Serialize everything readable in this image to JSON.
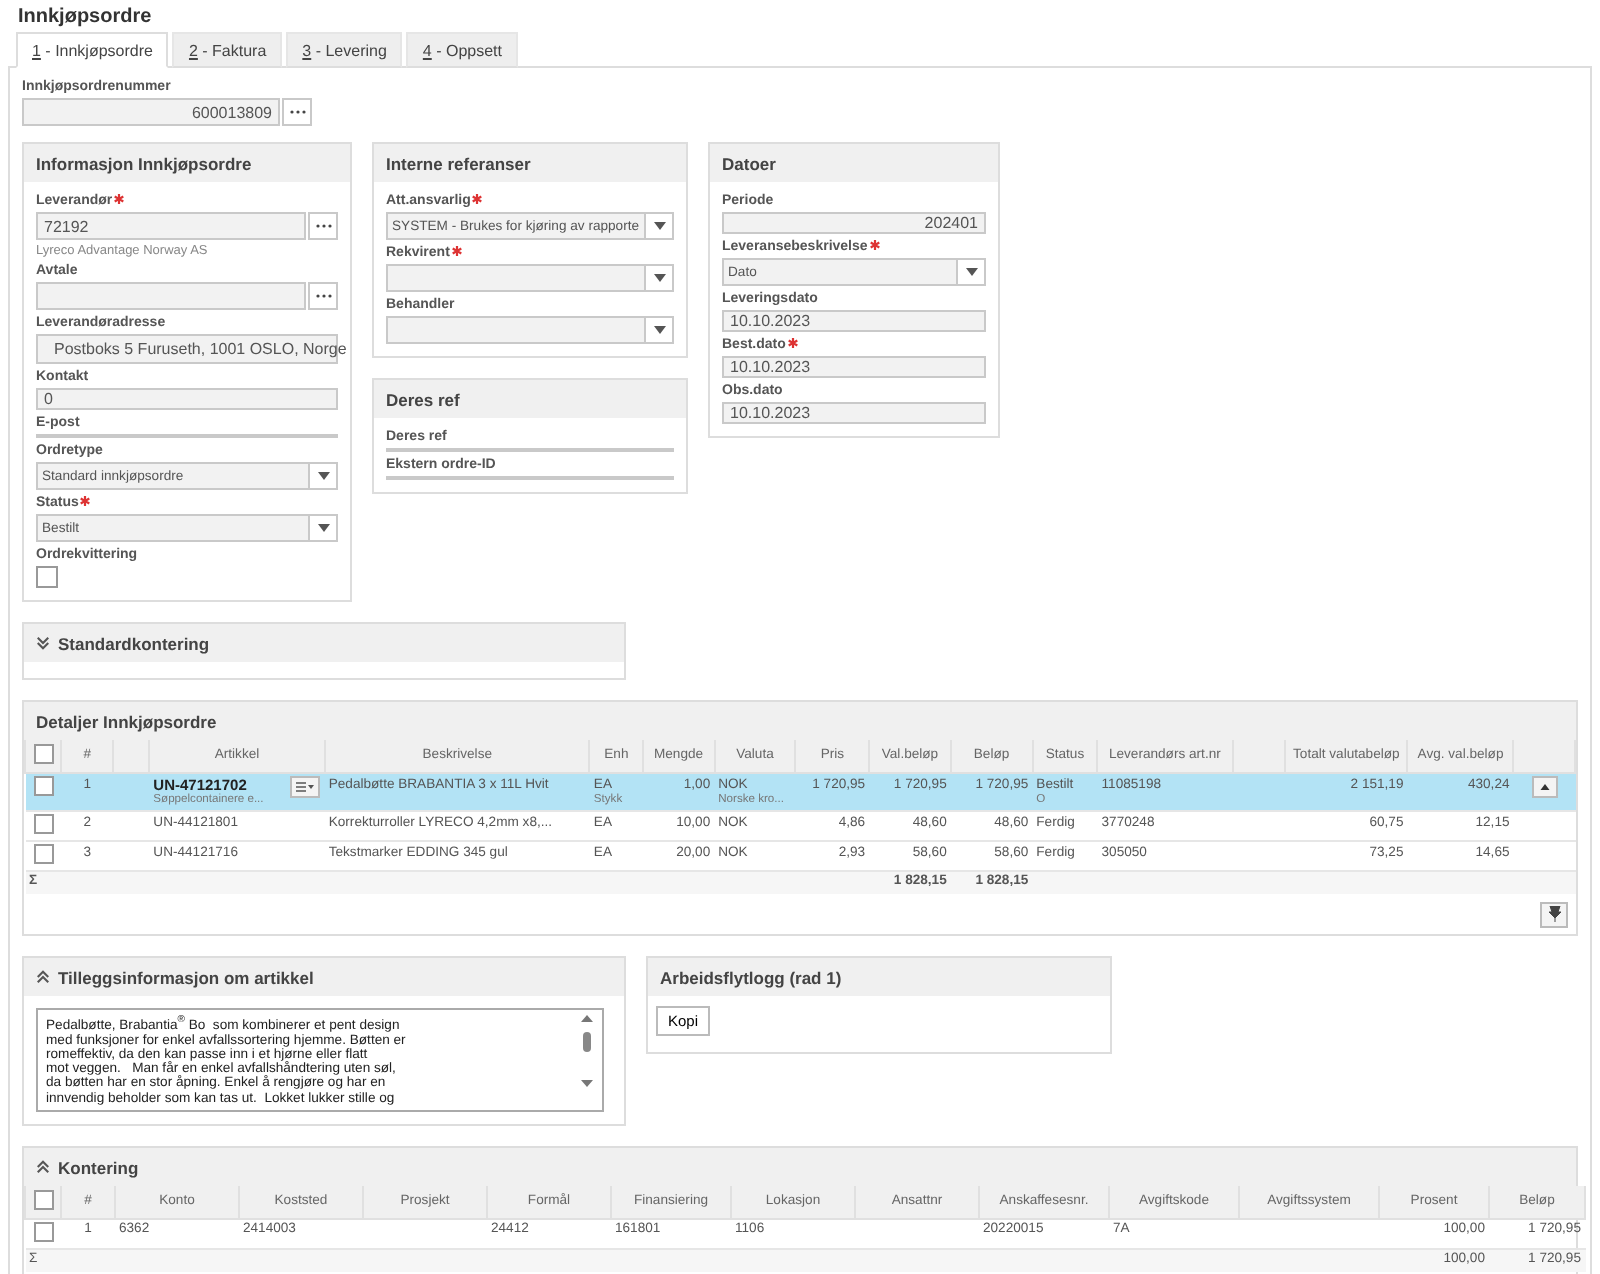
{
  "title": "Innkjøpsordre",
  "tabs": [
    {
      "label": "1 - Innkjøpsordre",
      "selected": true
    },
    {
      "label": "2 - Faktura",
      "selected": false
    },
    {
      "label": "3 - Levering",
      "selected": false
    },
    {
      "label": "4 - Oppsett",
      "selected": false
    }
  ],
  "order_number": {
    "label": "Innkjøpsordrenummer",
    "value": "600013809"
  },
  "sections": [
    {
      "title": "Informasjon Innkjøpsordre",
      "fields": [
        {
          "kind": "lookup",
          "label": "Leverandør",
          "required": true,
          "value": "72192"
        },
        {
          "kind": "note",
          "value": "Lyreco Advantage Norway AS"
        },
        {
          "kind": "lookup",
          "label": "Avtale",
          "required": false
        },
        {
          "kind": "textarea",
          "label": "Leverandøradresse",
          "required": false,
          "value": "Postboks 5 Furuseth, 1001 OSLO, Norge"
        },
        {
          "kind": "text",
          "label": "Kontakt",
          "required": false,
          "value": "0"
        },
        {
          "kind": "text",
          "label": "E-post",
          "required": false
        },
        {
          "kind": "select",
          "label": "Ordretype",
          "required": false,
          "value": "Standard innkjøpsordre"
        },
        {
          "kind": "select",
          "label": "Status",
          "required": true,
          "value": "Bestilt"
        },
        {
          "kind": "checkbox",
          "label": "Ordrekvittering",
          "required": false,
          "checked": false
        }
      ]
    },
    {
      "title": "Interne referanser",
      "fields": [
        {
          "kind": "select",
          "label": "Att.ansvarlig",
          "required": true,
          "value": "SYSTEM - Brukes for kjøring av rapporte"
        },
        {
          "kind": "select",
          "label": "Rekvirent",
          "required": true
        },
        {
          "kind": "select",
          "label": "Behandler",
          "required": false
        }
      ]
    },
    {
      "title": "Deres ref",
      "fields": [
        {
          "kind": "text",
          "label": "Deres ref",
          "required": false
        },
        {
          "kind": "text",
          "label": "Ekstern ordre-ID",
          "required": false
        }
      ]
    },
    {
      "title": "Datoer",
      "fields": [
        {
          "kind": "number",
          "label": "Periode",
          "required": false,
          "value": "202401"
        },
        {
          "kind": "select",
          "label": "Leveransebeskrivelse",
          "required": true,
          "value": "Dato"
        },
        {
          "kind": "text",
          "label": "Leveringsdato",
          "required": false,
          "value": "10.10.2023"
        },
        {
          "kind": "text",
          "label": "Best.dato",
          "required": true,
          "value": "10.10.2023"
        },
        {
          "kind": "text",
          "label": "Obs.dato",
          "required": false,
          "value": "10.10.2023"
        }
      ]
    }
  ],
  "standard_accounting": {
    "title": "Standardkontering",
    "expanded": false
  },
  "order_lines": {
    "title": "Detaljer Innkjøpsordre",
    "header_checked": false,
    "columns": [
      "#",
      "Artikkel",
      "Beskrivelse",
      "Enh",
      "Mengde",
      "Valuta",
      "Pris",
      "Val.beløp",
      "Beløp",
      "Status",
      "Leverandørs art.nr",
      "Totalt valutabeløp",
      "Avg. val.beløp"
    ],
    "rows": [
      {
        "selected": true,
        "checked": false,
        "cells": [
          "1",
          "UN-47121702",
          "Pedalbøtte BRABANTIA 3 x 11L Hvit",
          "EA",
          "1,00",
          "NOK",
          "1 720,95",
          "1 720,95",
          "1 720,95",
          "Bestilt",
          "11085198",
          "2 151,19",
          "430,24"
        ],
        "notes": {
          "1": "Søppelcontainere e...",
          "3": "Stykk",
          "5": "Norske kro...",
          "9": "O"
        }
      },
      {
        "selected": false,
        "checked": false,
        "cells": [
          "2",
          "UN-44121801",
          "Korrekturroller LYRECO 4,2mm x8,...",
          "EA",
          "10,00",
          "NOK",
          "4,86",
          "48,60",
          "48,60",
          "Ferdig",
          "3770248",
          "60,75",
          "12,15"
        ]
      },
      {
        "selected": false,
        "checked": false,
        "cells": [
          "3",
          "UN-44121716",
          "Tekstmarker EDDING 345 gul",
          "EA",
          "20,00",
          "NOK",
          "2,93",
          "58,60",
          "58,60",
          "Ferdig",
          "305050",
          "73,25",
          "14,65"
        ]
      }
    ],
    "sum_label": "Σ",
    "sums": {
      "7": "1 828,15",
      "8": "1 828,15"
    }
  },
  "article_info": {
    "title": "Tilleggsinformasjon om artikkel",
    "expanded": true,
    "text": "Pedalbøtte, Brabantia$^{®}$ Bo  som kombinerer et pent design\nmed funksjoner for enkel avfallssortering hjemme. Bøtten er\nromeffektiv, da den kan passe inn i et hjørne eller flatt\nmot veggen.   Man får en enkel avfallshåndtering uten søl,\nda bøtten har en stor åpning. Enkel å rengjøre og har en\ninnvendig beholder som kan tas ut.  Lokket lukker stille og"
  },
  "workflow_log": {
    "title": "Arbeidsflytlogg (rad 1)",
    "button": "Kopi"
  },
  "accounting": {
    "title": "Kontering",
    "expanded": true,
    "header_checked": false,
    "columns": [
      "#",
      "Konto",
      "Koststed",
      "Prosjekt",
      "Formål",
      "Finansiering",
      "Lokasjon",
      "Ansattnr",
      "Anskaffesesnr.",
      "Avgiftskode",
      "Avgiftssystem",
      "Prosent",
      "Beløp"
    ],
    "rows": [
      {
        "checked": false,
        "cells": [
          "1",
          "6362",
          "2414003",
          null,
          "24412",
          "161801",
          "1106",
          null,
          "20220015",
          "7A",
          null,
          "100,00",
          "1 720,95"
        ]
      }
    ],
    "sum_label": "Σ",
    "sums": {
      "11": "100,00",
      "12": "1 720,95"
    }
  }
}
